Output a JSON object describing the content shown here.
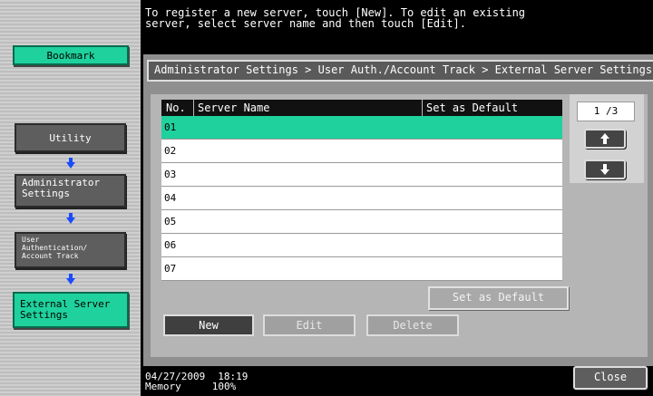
{
  "sidebar": {
    "bookmark_label": "Bookmark",
    "nav": [
      {
        "label": "Utility"
      },
      {
        "label": "Administrator\nSettings"
      },
      {
        "label": "User\nAuthentication/\nAccount Track"
      },
      {
        "label": "External Server\nSettings"
      }
    ]
  },
  "top_message": "To register a new server, touch [New]. To edit an existing\nserver, select server name and then touch [Edit].",
  "breadcrumb": "Administrator Settings > User Auth./Account Track > External Server Settings",
  "table": {
    "headers": [
      "No.",
      "Server Name",
      "Set as Default"
    ],
    "rows": [
      {
        "no": "01",
        "selected": true
      },
      {
        "no": "02"
      },
      {
        "no": "03"
      },
      {
        "no": "04"
      },
      {
        "no": "05"
      },
      {
        "no": "06"
      },
      {
        "no": "07"
      }
    ]
  },
  "pager": {
    "indicator": "1 /3",
    "up_icon": "arrow-up-icon",
    "down_icon": "arrow-down-icon"
  },
  "buttons": {
    "set_default": "Set as Default",
    "new": "New",
    "edit": "Edit",
    "delete": "Delete",
    "close": "Close"
  },
  "status": {
    "date": "04/27/2009",
    "time": "18:19",
    "memory_label": "Memory",
    "memory_value": "100%"
  },
  "colors": {
    "accent_green": "#1fd19c",
    "panel_gray": "#8f8f8f"
  }
}
